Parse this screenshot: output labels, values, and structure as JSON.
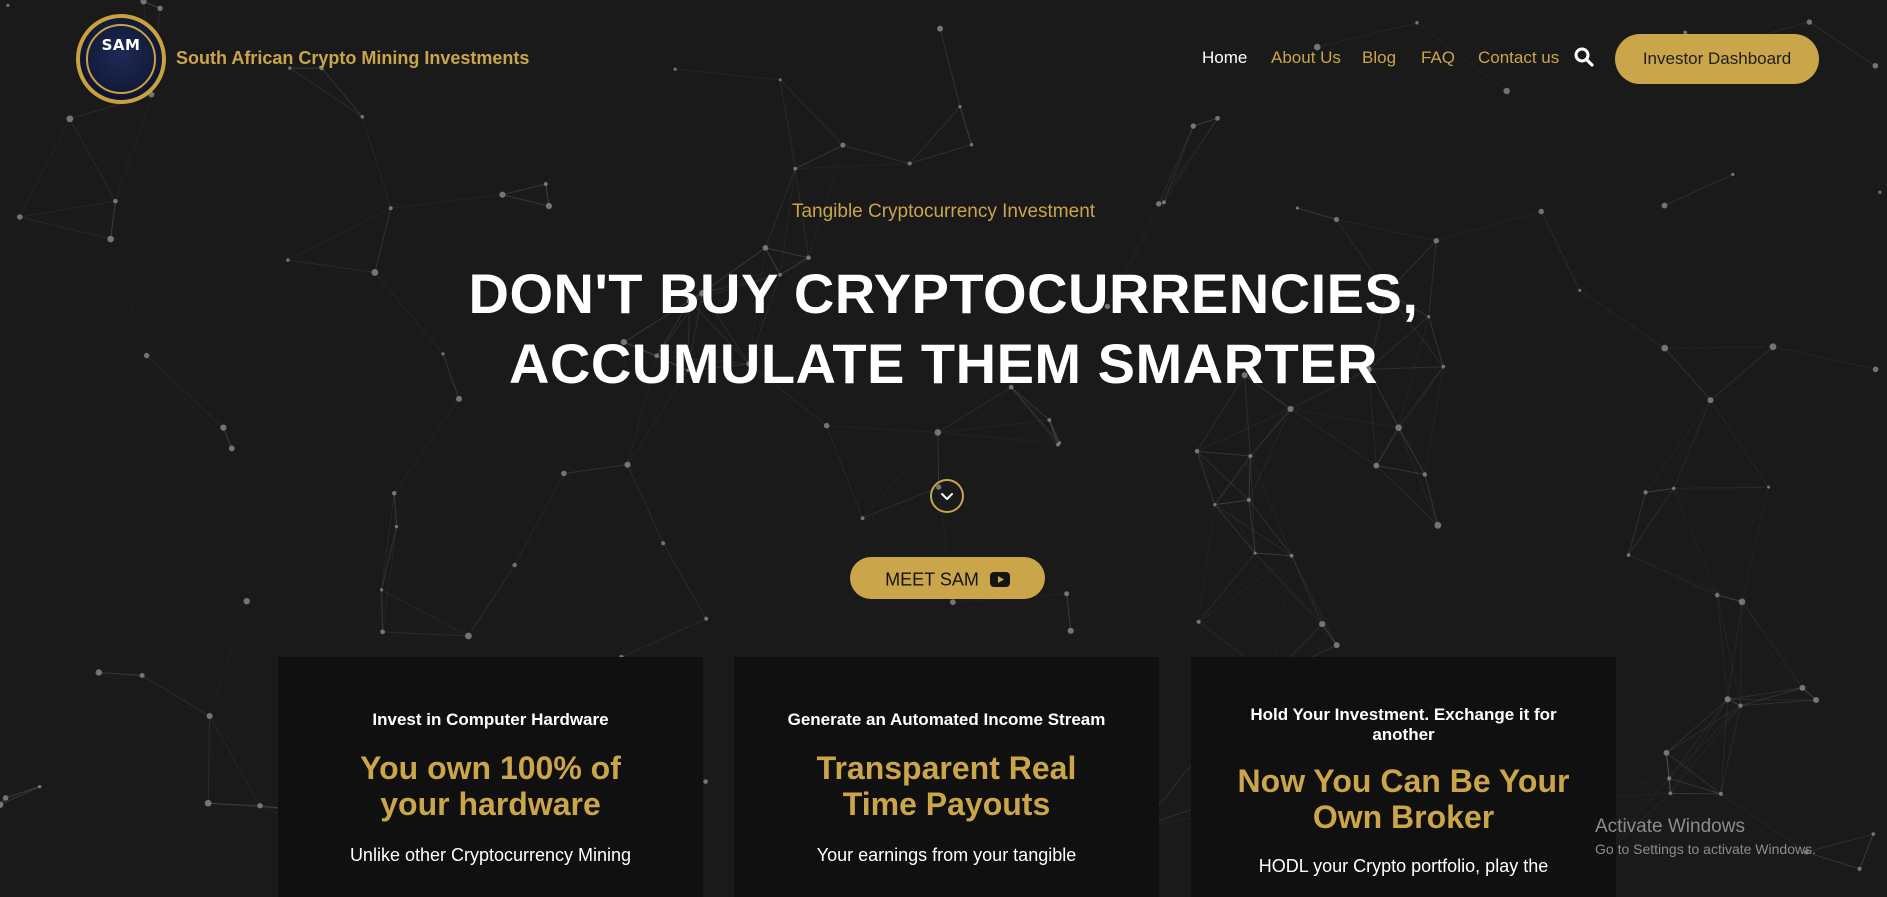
{
  "header": {
    "logo_text": "SAM",
    "brand": "South African Crypto Mining Investments",
    "nav": [
      "Home",
      "About Us",
      "Blog",
      "FAQ",
      "Contact us"
    ],
    "active_nav": "Home",
    "dashboard_button": "Investor Dashboard"
  },
  "hero": {
    "tagline": "Tangible Cryptocurrency Investment",
    "headline_line1": "DON'T BUY CRYPTOCURRENCIES,",
    "headline_line2": "ACCUMULATE THEM SMARTER",
    "meet_button": "MEET SAM"
  },
  "cards": [
    {
      "label": "Invest in Computer Hardware",
      "title_line1": "You own 100% of",
      "title_line2": "your hardware",
      "body": "Unlike other Cryptocurrency Mining"
    },
    {
      "label": "Generate an Automated Income Stream",
      "title_line1": "Transparent Real",
      "title_line2": "Time Payouts",
      "body": "Your earnings from your tangible"
    },
    {
      "label_line1": "Hold Your Investment. Exchange it for",
      "label_line2": "another",
      "title_line1": "Now You Can Be Your",
      "title_line2": "Own Broker",
      "body": "HODL your Crypto portfolio, play the"
    }
  ],
  "overlay": {
    "line1": "Activate Windows",
    "line2": "Go to Settings to activate Windows."
  },
  "colors": {
    "background": "#1a1a1a",
    "accent": "#caa54a",
    "card": "#101010",
    "text": "#ffffff"
  },
  "icons": [
    "search-icon",
    "chevron-down-icon",
    "youtube-icon"
  ]
}
